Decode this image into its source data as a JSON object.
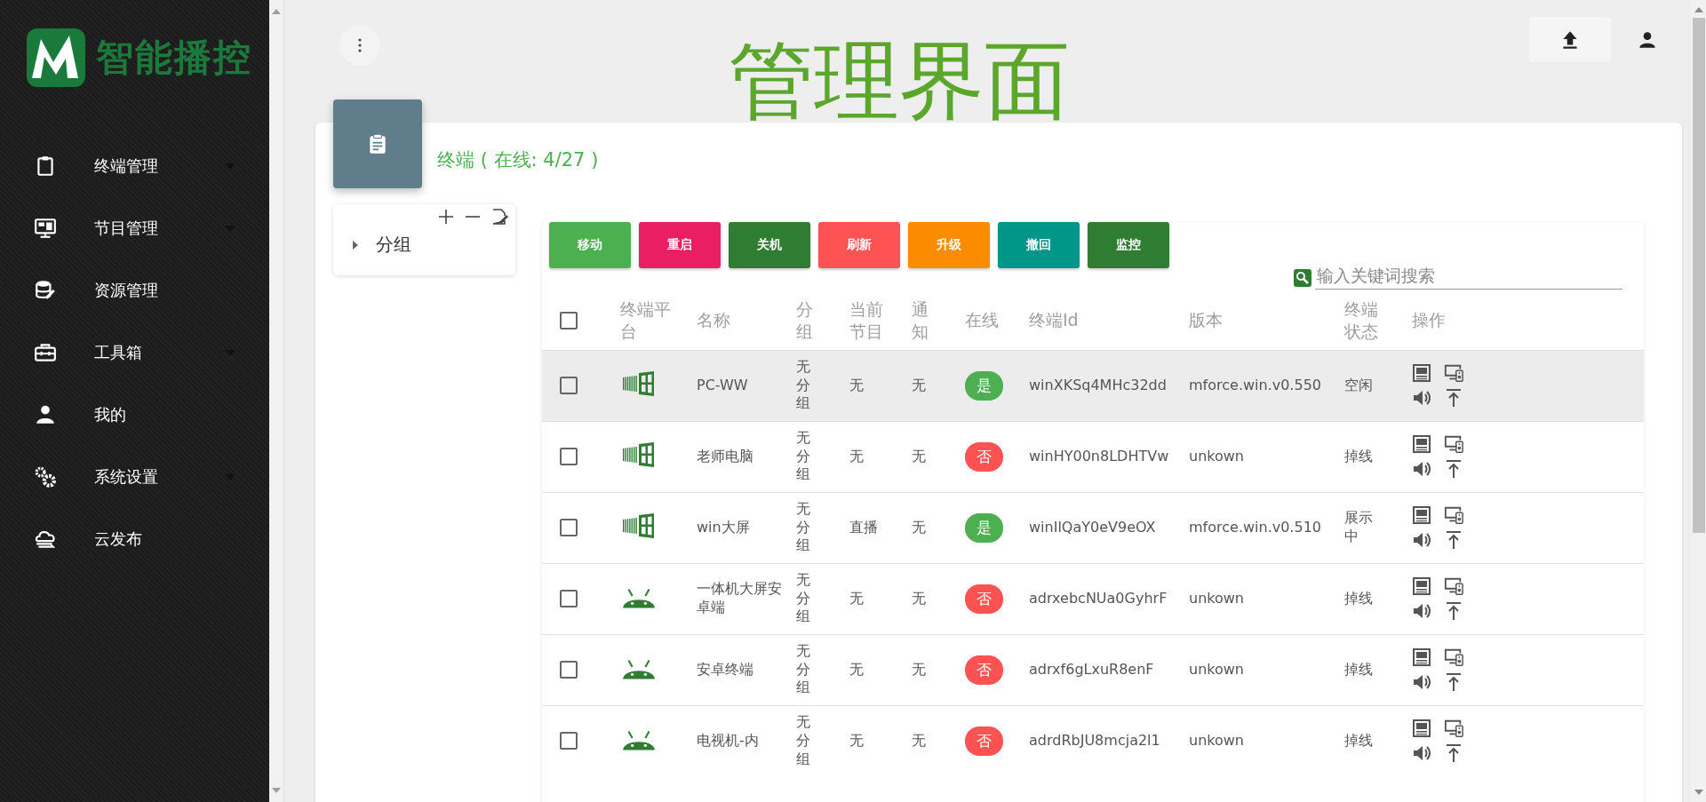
{
  "brand": {
    "name": "智能播控"
  },
  "sidebar": {
    "items": [
      {
        "label": "终端管理",
        "kind": "clipboard",
        "submenu": true
      },
      {
        "label": "节目管理",
        "kind": "monitor",
        "submenu": true
      },
      {
        "label": "资源管理",
        "kind": "database",
        "submenu": false
      },
      {
        "label": "工具箱",
        "kind": "toolbox",
        "submenu": true
      },
      {
        "label": "我的",
        "kind": "person",
        "submenu": false
      },
      {
        "label": "系统设置",
        "kind": "gears",
        "submenu": true
      },
      {
        "label": "云发布",
        "kind": "cloud",
        "submenu": false
      }
    ]
  },
  "page_title": "管理界面",
  "card": {
    "title": "终端 ( 在线: 4/27 )"
  },
  "tree": {
    "items": [
      {
        "label": "分组",
        "expanded": false
      }
    ]
  },
  "actions": [
    {
      "label": "移动",
      "color": "#4caf50"
    },
    {
      "label": "重启",
      "color": "#e91e63"
    },
    {
      "label": "关机",
      "color": "#2e7d32"
    },
    {
      "label": "刷新",
      "color": "#ff5252"
    },
    {
      "label": "升级",
      "color": "#fb8c00"
    },
    {
      "label": "撤回",
      "color": "#009688"
    },
    {
      "label": "监控",
      "color": "#2e7d32"
    }
  ],
  "search": {
    "placeholder": "输入关键词搜索"
  },
  "table": {
    "columns": [
      "终端平台",
      "名称",
      "分组",
      "当前节目",
      "通知",
      "在线",
      "终端Id",
      "版本",
      "终端状态",
      "操作"
    ],
    "header_checked": false,
    "rows": [
      {
        "selected": true,
        "checked": false,
        "kind": "windows",
        "name": "PC-WW",
        "group": "无分组",
        "program": "无",
        "notice": "无",
        "online": true,
        "online_label": "是",
        "id": "winXKSq4MHc32dd",
        "version": "mforce.win.v0.550",
        "status": "空闲"
      },
      {
        "selected": false,
        "checked": false,
        "kind": "windows",
        "name": "老师电脑",
        "group": "无分组",
        "program": "无",
        "notice": "无",
        "online": false,
        "online_label": "否",
        "id": "winHY00n8LDHTVw",
        "version": "unkown",
        "status": "掉线"
      },
      {
        "selected": false,
        "checked": false,
        "kind": "windows",
        "name": "win大屏",
        "group": "无分组",
        "program": "直播",
        "notice": "无",
        "online": true,
        "online_label": "是",
        "id": "winIlQaY0eV9eOX",
        "version": "mforce.win.v0.510",
        "status": "展示中"
      },
      {
        "selected": false,
        "checked": false,
        "kind": "android",
        "name": "一体机大屏安卓端",
        "group": "无分组",
        "program": "无",
        "notice": "无",
        "online": false,
        "online_label": "否",
        "id": "adrxebcNUa0GyhrF",
        "version": "unkown",
        "status": "掉线"
      },
      {
        "selected": false,
        "checked": false,
        "kind": "android",
        "name": "安卓终端",
        "group": "无分组",
        "program": "无",
        "notice": "无",
        "online": false,
        "online_label": "否",
        "id": "adrxf6gLxuR8enF",
        "version": "unkown",
        "status": "掉线"
      },
      {
        "selected": false,
        "checked": false,
        "kind": "android",
        "name": "电视机-内",
        "group": "无分组",
        "program": "无",
        "notice": "无",
        "online": false,
        "online_label": "否",
        "id": "adrdRbJU8mcja2l1",
        "version": "unkown",
        "status": "掉线"
      }
    ]
  }
}
